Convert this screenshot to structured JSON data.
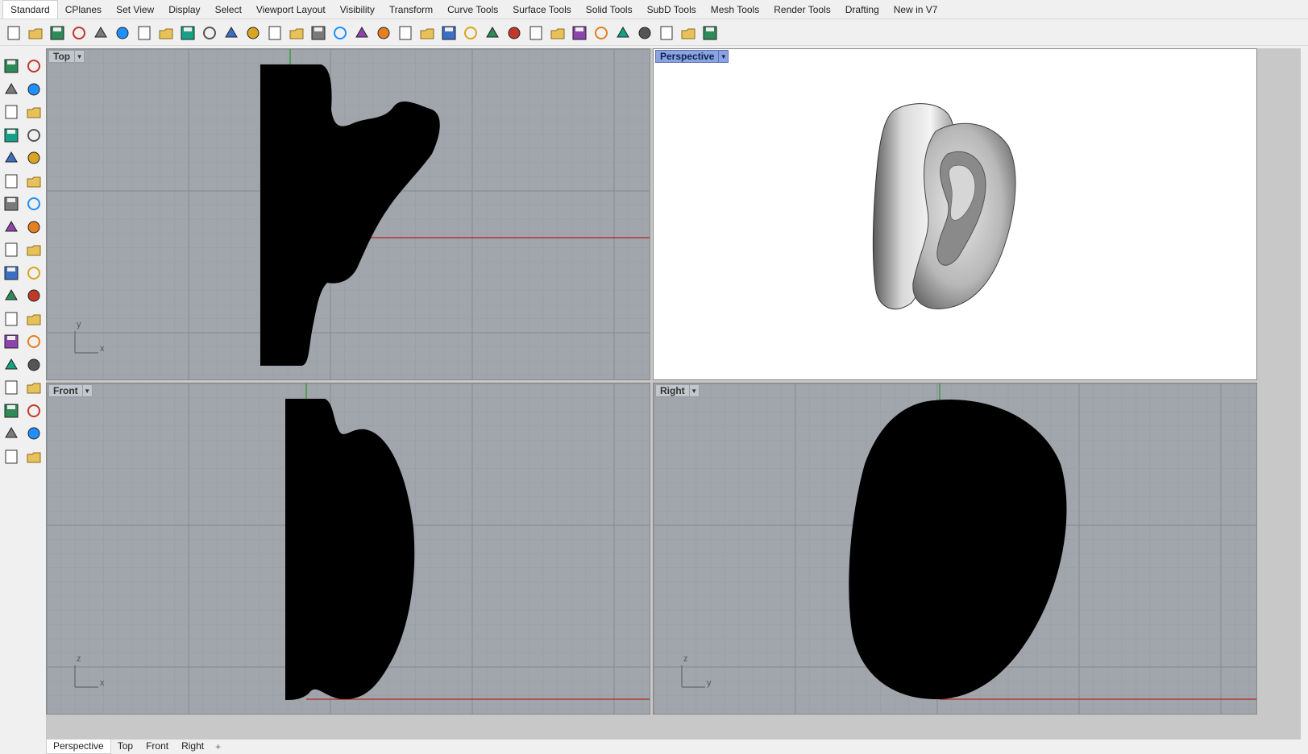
{
  "toolbar_tabs": [
    "Standard",
    "CPlanes",
    "Set View",
    "Display",
    "Select",
    "Viewport Layout",
    "Visibility",
    "Transform",
    "Curve Tools",
    "Surface Tools",
    "Solid Tools",
    "SubD Tools",
    "Mesh Tools",
    "Render Tools",
    "Drafting",
    "New in V7"
  ],
  "active_tab": "Standard",
  "icon_toolbar": [
    "new-file",
    "open-folder",
    "save",
    "print",
    "import",
    "cut",
    "copy",
    "paste",
    "undo",
    "pan-hand",
    "rotate-view",
    "zoom",
    "zoom-window",
    "zoom-extents",
    "zoom-selected",
    "undo-view",
    "four-viewports",
    "car-properties",
    "car-display",
    "circle-dim",
    "osnap",
    "light-bulb",
    "lock",
    "color-picker",
    "color-wheel",
    "sphere-gray",
    "sphere-shaded",
    "sphere-blue",
    "highlighter",
    "settings-gear",
    "crop-layout",
    "render-globe",
    "help"
  ],
  "sidebar_tools": [
    "select-arrow",
    "point",
    "polyline",
    "curve-control",
    "circle",
    "ellipse",
    "polygon",
    "rectangle",
    "polygon-arc",
    "fillet-curve",
    "surface-from-points",
    "extrude-surface",
    "box-solid",
    "boolean-union",
    "cylinder-solid",
    "plane-surface",
    "mesh-tool",
    "explode",
    "transform-move",
    "gumball",
    "boolean-tools",
    "sphere-cluster",
    "curve-edit",
    "blend-curve",
    "text-object",
    "array",
    "group-objects",
    "edit-points",
    "box-mesh",
    "ruler",
    "grid-array",
    "align",
    "extrude-solid",
    "check-mark",
    "shade",
    "layers"
  ],
  "viewports": {
    "top": {
      "label": "Top",
      "axis_v": "y",
      "axis_h": "x"
    },
    "perspective": {
      "label": "Perspective"
    },
    "front": {
      "label": "Front",
      "axis_v": "z",
      "axis_h": "x"
    },
    "right": {
      "label": "Right",
      "axis_v": "z",
      "axis_h": "y"
    }
  },
  "bottom_tabs": [
    "Perspective",
    "Top",
    "Front",
    "Right"
  ],
  "bottom_add": "+",
  "colors": {
    "grid_bg": "#a1a6ad",
    "grid_major": "#8a8e94",
    "grid_minor": "#999da4",
    "x_axis": "#b22222",
    "y_axis": "#1f9a1f",
    "active_label": "#8aa4e3",
    "mesh": "#000000"
  }
}
